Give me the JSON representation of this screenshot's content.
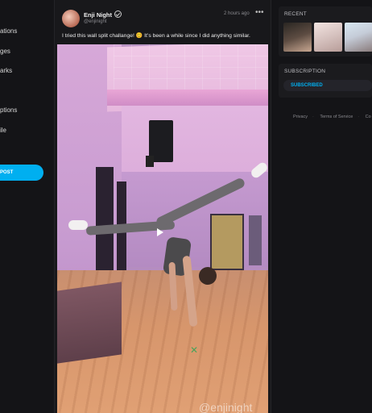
{
  "sidebar": {
    "items": [
      {
        "label": "ations"
      },
      {
        "label": "ges"
      },
      {
        "label": "arks"
      },
      {
        "label": "ptions"
      },
      {
        "label": "ile"
      }
    ],
    "post_button": "POST"
  },
  "post": {
    "author": "Enji Night",
    "handle": "@enjinight",
    "time": "2 hours ago",
    "more": "•••",
    "caption": "I tried this wall split challange! 😊 It’s been a while since I did anything similar.",
    "watermark": "@enjinight"
  },
  "right": {
    "recent_title": "RECENT",
    "subscription_title": "SUBSCRIPTION",
    "subscribed_label": "SUBSCRIBED",
    "footer": [
      "Privacy",
      "Terms of Service",
      "Co"
    ]
  },
  "colors": {
    "accent": "#00aff0",
    "bg": "#141417"
  }
}
